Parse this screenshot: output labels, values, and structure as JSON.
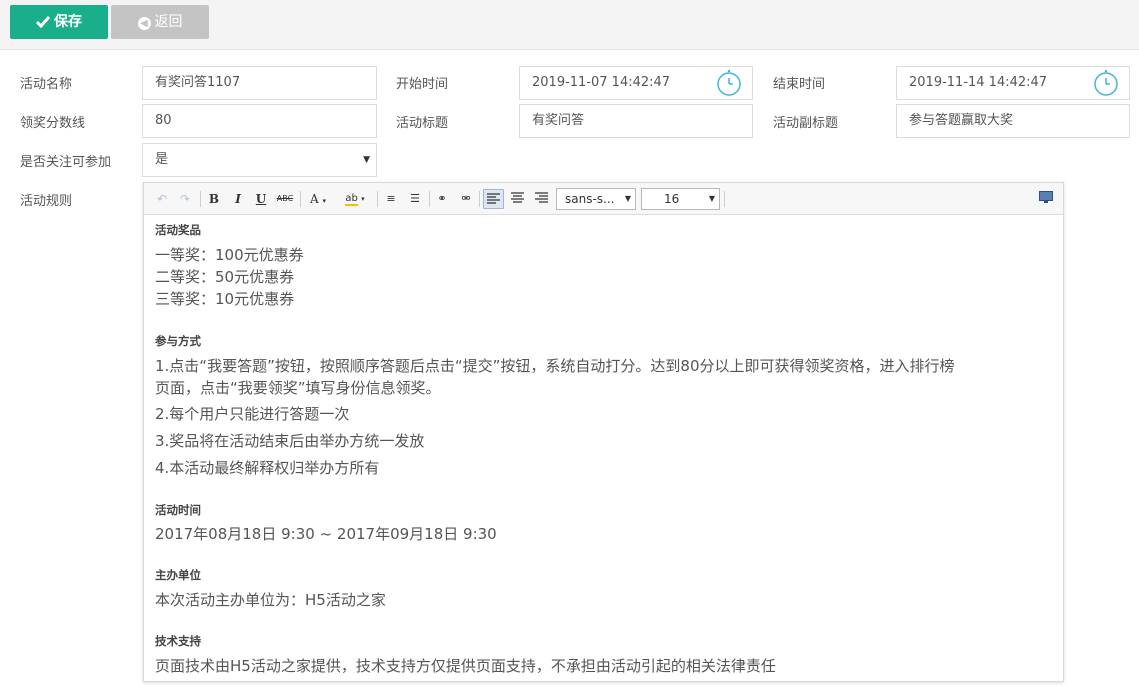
{
  "toolbar": {
    "save_label": "保存",
    "back_label": "返回"
  },
  "form": {
    "activity_name": {
      "label": "活动名称",
      "value": "有奖问答1107"
    },
    "start_time": {
      "label": "开始时间",
      "value": "2019-11-07 14:42:47"
    },
    "end_time": {
      "label": "结束时间",
      "value": "2019-11-14 14:42:47"
    },
    "score_line": {
      "label": "领奖分数线",
      "value": "80"
    },
    "activity_title": {
      "label": "活动标题",
      "value": "有奖问答"
    },
    "activity_subtitle": {
      "label": "活动副标题",
      "value": "参与答题赢取大奖"
    },
    "follow_required": {
      "label": "是否关注可参加",
      "value": "是"
    },
    "rules": {
      "label": "活动规则"
    }
  },
  "editor": {
    "font_family": "sans-s...",
    "font_size": "16",
    "sections": [
      {
        "title": "活动奖品",
        "lines": [
          "一等奖：100元优惠券",
          "二等奖：50元优惠券",
          "三等奖：10元优惠券"
        ]
      },
      {
        "title": "参与方式",
        "lines": [
          "1.点击“我要答题”按钮，按照顺序答题后点击“提交”按钮，系统自动打分。达到80分以上即可获得领奖资格，进入排行榜",
          "页面，点击“我要领奖”填写身份信息领奖。",
          "2.每个用户只能进行答题一次",
          "3.奖品将在活动结束后由举办方统一发放",
          "4.本活动最终解释权归举办方所有"
        ]
      },
      {
        "title": "活动时间",
        "lines": [
          "2017年08月18日 9:30 ~ 2017年09月18日 9:30"
        ]
      },
      {
        "title": "主办单位",
        "lines": [
          "本次活动主办单位为：H5活动之家"
        ]
      },
      {
        "title": "技术支持",
        "lines": [
          "页面技术由H5活动之家提供，技术支持方仅提供页面支持，不承担由活动引起的相关法律责任"
        ]
      }
    ]
  },
  "colors": {
    "save": "#1aaf8b",
    "back": "#c4c4c4",
    "clock": "#41b4d8"
  }
}
